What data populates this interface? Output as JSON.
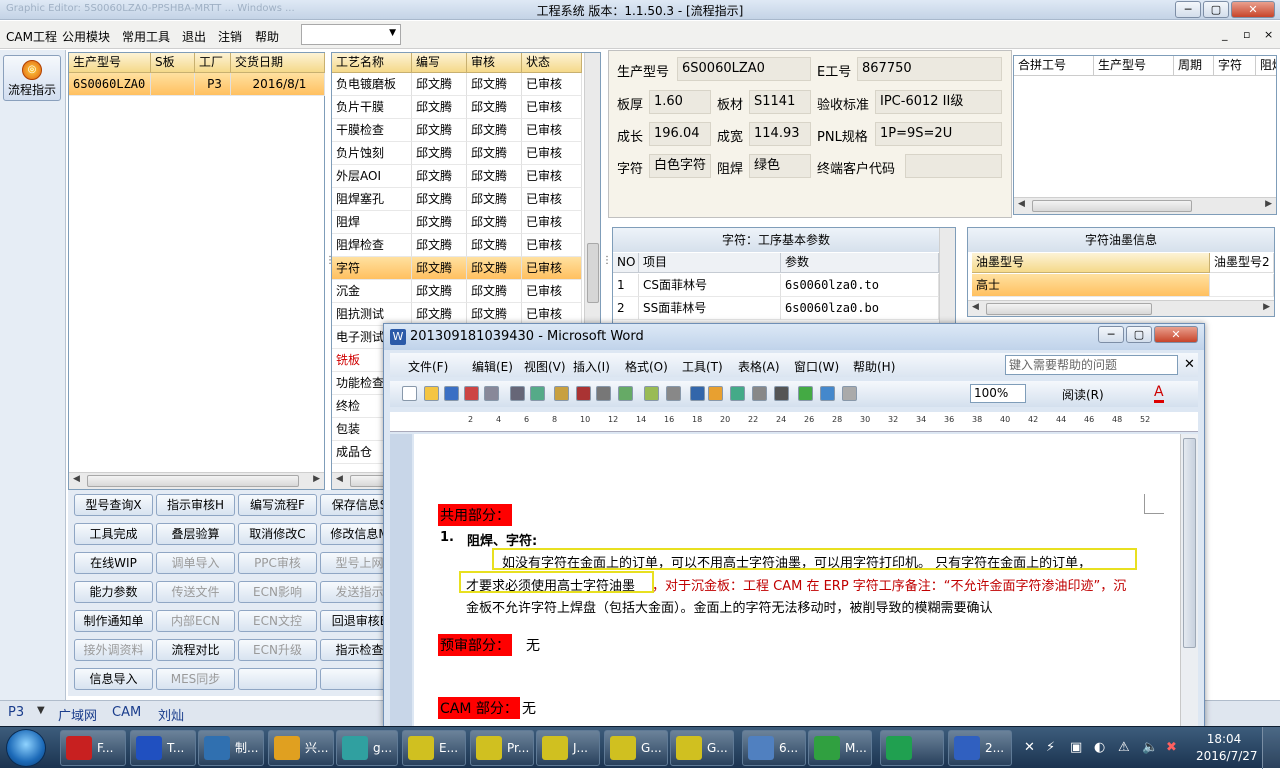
{
  "app": {
    "title": "工程系统  版本：1.1.50.3 - [流程指示]",
    "ghost_title": "Graphic Editor: 5S0060LZA0-PPSHBA-MRTT ... Windows ...",
    "min": "─",
    "max": "▢",
    "close": "✕"
  },
  "menu": {
    "items": [
      "CAM工程",
      "公用模块",
      "常用工具",
      "退出",
      "注销",
      "帮助"
    ],
    "select_value": "",
    "mdi_min": "_",
    "mdi_restore": "▫",
    "mdi_close": "×"
  },
  "left_tool": {
    "flow_label": "流程指示",
    "flow_icon_text": "◎"
  },
  "orders": {
    "headers": [
      "生产型号",
      "S板",
      "工厂",
      "交货日期"
    ],
    "rows": [
      [
        "6S0060LZA0",
        "",
        "P3",
        "2016/8/1"
      ]
    ]
  },
  "process": {
    "headers": [
      "工艺名称",
      "编写",
      "审核",
      "状态"
    ],
    "rows": [
      [
        "负电镀磨板",
        "邱文腾",
        "邱文腾",
        "已审核"
      ],
      [
        "负片干膜",
        "邱文腾",
        "邱文腾",
        "已审核"
      ],
      [
        "干膜检查",
        "邱文腾",
        "邱文腾",
        "已审核"
      ],
      [
        "负片蚀刻",
        "邱文腾",
        "邱文腾",
        "已审核"
      ],
      [
        "外层AOI",
        "邱文腾",
        "邱文腾",
        "已审核"
      ],
      [
        "阻焊塞孔",
        "邱文腾",
        "邱文腾",
        "已审核"
      ],
      [
        "阻焊",
        "邱文腾",
        "邱文腾",
        "已审核"
      ],
      [
        "阻焊检查",
        "邱文腾",
        "邱文腾",
        "已审核"
      ],
      [
        "字符",
        "邱文腾",
        "邱文腾",
        "已审核"
      ],
      [
        "沉金",
        "邱文腾",
        "邱文腾",
        "已审核"
      ],
      [
        "阻抗测试",
        "邱文腾",
        "邱文腾",
        "已审核"
      ],
      [
        "电子测试",
        "",
        "",
        ""
      ],
      [
        "铣板",
        "",
        "",
        ""
      ],
      [
        "功能检查",
        "",
        "",
        ""
      ],
      [
        "终检",
        "",
        "",
        ""
      ],
      [
        "包装",
        "",
        "",
        ""
      ],
      [
        "成品仓",
        "",
        "",
        ""
      ]
    ],
    "selected_index": 8
  },
  "buttons": [
    [
      "型号查询X",
      "指示审核H",
      "编写流程F",
      "保存信息S"
    ],
    [
      "工具完成",
      "叠层验算",
      "取消修改C",
      "修改信息M"
    ],
    [
      "在线WIP",
      "调单导入",
      "PPC审核",
      "型号上网"
    ],
    [
      "能力参数",
      "传送文件",
      "ECN影响",
      "发送指示"
    ],
    [
      "制作通知单",
      "内部ECN",
      "ECN文控",
      "回退审核E"
    ],
    [
      "接外调资料",
      "流程对比",
      "ECN升级",
      "指示检查"
    ],
    [
      "信息导入",
      "MES同步",
      "",
      ""
    ]
  ],
  "info": {
    "model_label": "生产型号",
    "model_value": "6S0060LZA0",
    "e_label": "E工号",
    "e_value": "867750",
    "thick_label": "板厚",
    "thick_value": "1.60",
    "material_label": "板材",
    "material_value": "S1141",
    "std_label": "验收标准",
    "std_value": "IPC-6012 II级",
    "len_label": "成长",
    "len_value": "196.04",
    "wid_label": "成宽",
    "wid_value": "114.93",
    "pnl_label": "PNL规格",
    "pnl_value": "1P=9S=2U",
    "char_label": "字符",
    "char_value": "白色字符",
    "mask_label": "阻焊",
    "mask_value": "绿色",
    "cust_label": "终端客户代码",
    "cust_value": ""
  },
  "merge": {
    "headers": [
      "合拼工号",
      "生产型号",
      "周期",
      "字符",
      "阻焊"
    ]
  },
  "params": {
    "title": "字符：工序基本参数",
    "headers": [
      "NO",
      "项目",
      "参数"
    ],
    "rows": [
      [
        "1",
        "CS面菲林号",
        "6s0060lza0.to"
      ],
      [
        "2",
        "SS面菲林号",
        "6s0060lza0.bo"
      ]
    ]
  },
  "ink": {
    "title": "字符油墨信息",
    "headers": [
      "油墨型号",
      "油墨型号2"
    ],
    "rows": [
      [
        "高士",
        ""
      ]
    ]
  },
  "status": {
    "items": [
      "P3",
      "广域网",
      "CAM",
      "刘灿"
    ],
    "arrow": "▼"
  },
  "taskbar": {
    "items": [
      "F...",
      "T...",
      "制...",
      "兴...",
      "g...",
      "E...",
      "Pr...",
      "J...",
      "G...",
      "G...",
      "6...",
      "M...",
      "",
      "2..."
    ],
    "time": "18:04",
    "date": "2016/7/27"
  },
  "word": {
    "title": "201309181039430 - Microsoft Word",
    "menu": [
      "文件(F)",
      "编辑(E)",
      "视图(V)",
      "插入(I)",
      "格式(O)",
      "工具(T)",
      "表格(A)",
      "窗口(W)",
      "帮助(H)"
    ],
    "help_placeholder": "键入需要帮助的问题",
    "zoom": "100%",
    "read_label": "阅读(R)",
    "ruler": [
      "2",
      "4",
      "6",
      "8",
      "10",
      "12",
      "14",
      "16",
      "18",
      "20",
      "22",
      "24",
      "26",
      "28",
      "30",
      "32",
      "34",
      "36",
      "38",
      "40",
      "42",
      "44",
      "46",
      "48",
      "52"
    ],
    "doc": {
      "h1": "共用部分：",
      "item_num": "1.",
      "item_title": "阻焊、字符:",
      "p1": "如没有字符在金面上的订单，可以不用高士字符油墨，可以用字符打印机。   只有字符在金面上的订单，",
      "p2a": "才要求必须使用高士字符油墨",
      "p2b": "，对于沉金板：工程 CAM 在 ERP 字符工序备注：“不允许金面字符渗油印迹”，沉",
      "p3": "金板不允许字符上焊盘（包括大金面）。金面上的字符无法移动时，被削导致的模糊需要确认",
      "h2": "预审部分：",
      "h2v": "无",
      "h3": "CAM 部分：",
      "h3v": "无"
    }
  }
}
